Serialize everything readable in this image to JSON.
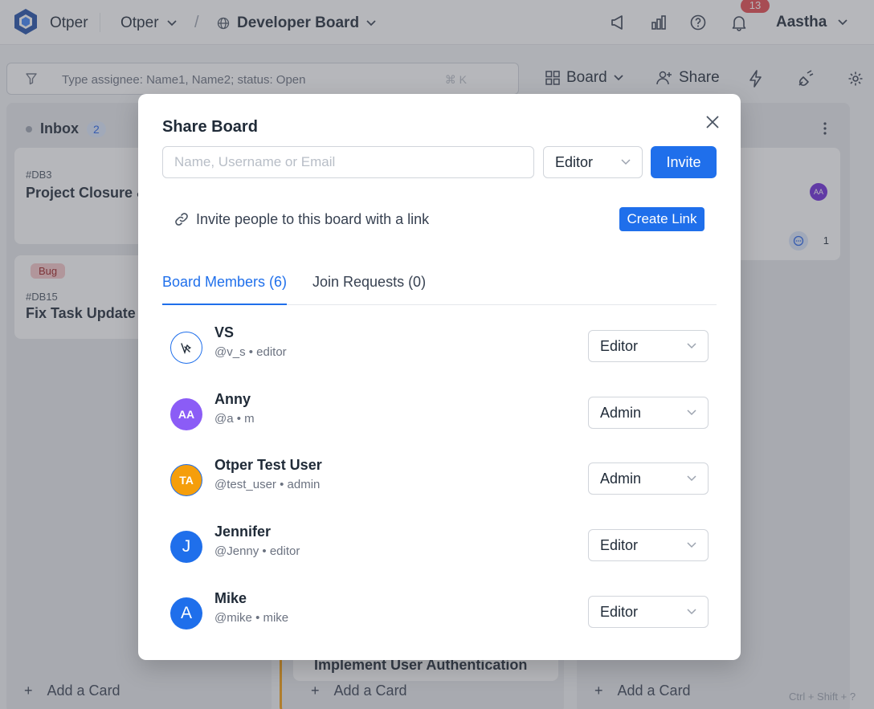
{
  "topbar": {
    "app_name": "Otper",
    "workspace": "Otper",
    "crumb_separator": "/",
    "board_name": "Developer Board",
    "notification_count": "13",
    "user_name": "Aastha"
  },
  "toolbar": {
    "filter_placeholder": "Type assignee: Name1, Name2; status: Open",
    "filter_shortcut": "⌘ K",
    "board_label": "Board",
    "share_label": "Share"
  },
  "columns": [
    {
      "title": "Inbox",
      "count": "2",
      "cards": [
        {
          "id": "#DB3",
          "title": "Project Closure &"
        },
        {
          "tag": "Bug",
          "id": "#DB15",
          "title": "Fix Task Update B"
        }
      ],
      "add_label": "Add a Card"
    },
    {
      "partial_card_title": "Implement User Authentication",
      "add_label": "Add a Card"
    },
    {
      "card_avatar": "AA",
      "comment_count": "1",
      "add_label": "Add a Card"
    }
  ],
  "shortcut_hint": "Ctrl + Shift + ?",
  "modal": {
    "title": "Share Board",
    "invite_placeholder": "Name, Username or Email",
    "invite_role": "Editor",
    "invite_button": "Invite",
    "link_text": "Invite people to this board with a link",
    "create_link_button": "Create Link",
    "tabs": [
      {
        "label": "Board Members (6)",
        "active": true
      },
      {
        "label": "Join Requests (0)",
        "active": false
      }
    ],
    "members": [
      {
        "name": "VS",
        "handle": "@v_s • editor",
        "initials": "",
        "avatar_color": "#ffffff",
        "role": "Editor"
      },
      {
        "name": "Anny",
        "handle": "@a • m",
        "initials": "AA",
        "avatar_color": "#8b5cf6",
        "role": "Admin"
      },
      {
        "name": "Otper Test User",
        "handle": "@test_user • admin",
        "initials": "TA",
        "avatar_color": "#f59e0b",
        "role": "Admin"
      },
      {
        "name": "Jennifer",
        "handle": "@Jenny • editor",
        "initials": "J",
        "avatar_color": "#1f6feb",
        "role": "Editor"
      },
      {
        "name": "Mike",
        "handle": "@mike • mike",
        "initials": "A",
        "avatar_color": "#1f6feb",
        "role": "Editor"
      }
    ]
  },
  "colors": {
    "primary": "#1f6feb",
    "notification": "#e5484d"
  }
}
